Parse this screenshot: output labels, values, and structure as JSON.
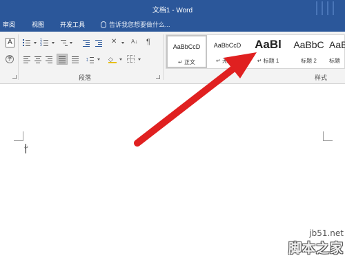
{
  "window": {
    "title": "文档1 - Word"
  },
  "tabs": [
    {
      "label": "审阅"
    },
    {
      "label": "视图"
    },
    {
      "label": "开发工具"
    }
  ],
  "tell_me": {
    "text": "告诉我您想要做什么..."
  },
  "ribbon": {
    "font_group": {
      "text_effect_glyph": "A",
      "enclose_glyph": "字"
    },
    "paragraph_group": {
      "label": "段落",
      "active_button": "justify"
    },
    "styles_group": {
      "label": "样式",
      "items": [
        {
          "sample": "AaBbCcD",
          "name": "正文",
          "mark": "↵",
          "selected": true
        },
        {
          "sample": "AaBbCcD",
          "name": "无间隔",
          "mark": "↵",
          "selected": false
        },
        {
          "sample": "AaBl",
          "name": "标题 1",
          "mark": "↵",
          "selected": false
        },
        {
          "sample": "AaBbC",
          "name": "标题 2",
          "mark": "",
          "selected": false
        },
        {
          "sample": "AaB",
          "name": "标题",
          "mark": "",
          "selected": false
        }
      ]
    }
  },
  "document": {
    "paragraph_mark": "↵"
  },
  "annotation": {
    "arrow_color": "#e02020"
  },
  "watermark": {
    "site": "jb51.net",
    "name": "脚本之家"
  },
  "colors": {
    "title_bar": "#2b579a",
    "ribbon": "#f3f3f3"
  }
}
